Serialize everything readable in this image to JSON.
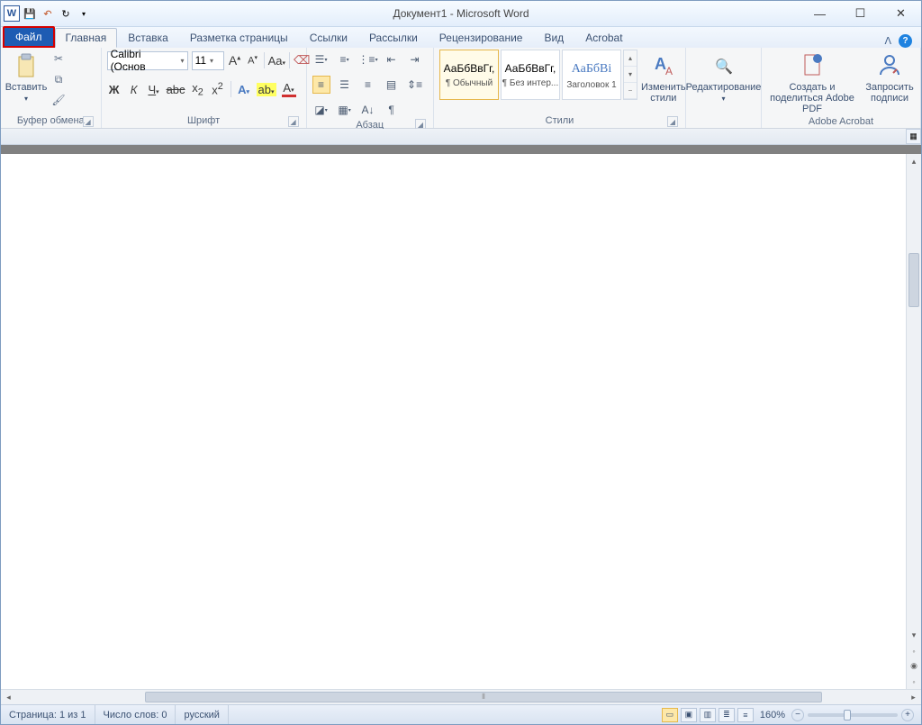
{
  "title": "Документ1 - Microsoft Word",
  "tabs": {
    "file": "Файл",
    "home": "Главная",
    "insert": "Вставка",
    "layout": "Разметка страницы",
    "refs": "Ссылки",
    "mail": "Рассылки",
    "review": "Рецензирование",
    "view": "Вид",
    "acrobat": "Acrobat"
  },
  "groups": {
    "clipboard": "Буфер обмена",
    "font": "Шрифт",
    "paragraph": "Абзац",
    "styles": "Стили",
    "editing": "Редактирование",
    "adobe": "Adobe Acrobat"
  },
  "clipboard": {
    "paste": "Вставить"
  },
  "font": {
    "name": "Calibri (Основ",
    "size": "11"
  },
  "styles": {
    "items": [
      {
        "preview": "АаБбВвГг,",
        "name": "¶ Обычный"
      },
      {
        "preview": "АаБбВвГг,",
        "name": "¶ Без интер..."
      },
      {
        "preview": "АаБбВі",
        "name": "Заголовок 1"
      }
    ],
    "change": "Изменить стили"
  },
  "adobe": {
    "create": "Создать и поделиться Adobe PDF",
    "sign": "Запросить подписи"
  },
  "status": {
    "page": "Страница: 1 из 1",
    "words": "Число слов: 0",
    "lang": "русский",
    "zoom": "160%"
  }
}
